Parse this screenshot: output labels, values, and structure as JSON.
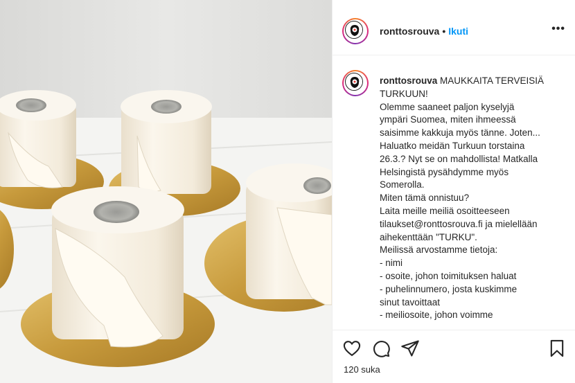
{
  "header": {
    "username": "ronttosrouva",
    "dot": "•",
    "follow_label": "Ikuti",
    "more_label": "•••"
  },
  "caption": {
    "username": "ronttosrouva",
    "first_line_text": " MAUKKAITA TERVEISIÄ",
    "lines": [
      "TURKUUN!",
      "Olemme saaneet paljon kyselyjä",
      "ympäri Suomea, miten ihmeessä",
      "saisimme kakkuja myös tänne. Joten...",
      "Haluatko meidän Turkuun torstaina",
      "26.3.? Nyt se on mahdollista! Matkalla",
      "Helsingistä pysähdymme myös",
      "Somerolla.",
      "Miten tämä onnistuu?",
      "Laita meille meiliä osoitteeseen",
      "tilaukset@ronttosrouva.fi ja mielellään",
      "aihekenttään \"TURKU\".",
      "Meilissä arvostamme tietoja:",
      "- nimi",
      "- osoite, johon toimituksen haluat",
      "- puhelinnumero, josta kuskimme",
      "sinut tavoittaat",
      "- meiliosoite, johon voimme"
    ]
  },
  "actions": {
    "like_icon": "heart-icon",
    "comment_icon": "comment-icon",
    "share_icon": "share-icon",
    "save_icon": "bookmark-icon"
  },
  "likes_text": "120 suka",
  "colors": {
    "follow": "#0095f6",
    "text": "#262626",
    "gold": "#c9a24a",
    "cake": "#f6efe2"
  }
}
